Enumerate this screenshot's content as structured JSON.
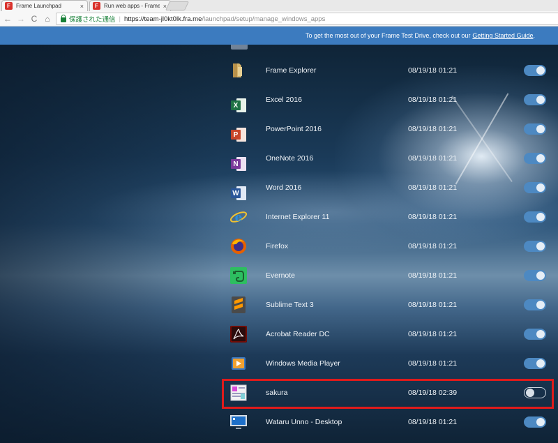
{
  "browser": {
    "tabs": [
      {
        "title": "Frame Launchpad",
        "favicon": "F",
        "close": "×"
      },
      {
        "title": "Run web apps - Frame De",
        "favicon": "F",
        "close": "×"
      }
    ],
    "nav": {
      "back": "←",
      "forward": "→",
      "reload": "C",
      "home": "⌂"
    },
    "address": {
      "secure_label": "保護された通信",
      "separator": "|",
      "host": "https://team-jl0kt0lk.fra.me",
      "path": "/launchpad/setup/manage_windows_apps"
    }
  },
  "banner": {
    "text": "To get the most out of your Frame Test Drive, check out our",
    "link": "Getting Started Guide",
    "trailing": "."
  },
  "apps": [
    {
      "name": "Frame Explorer",
      "date": "08/19/18 01:21",
      "icon": "folder-icon",
      "enabled": true
    },
    {
      "name": "Excel 2016",
      "date": "08/19/18 01:21",
      "icon": "excel-icon",
      "enabled": true
    },
    {
      "name": "PowerPoint 2016",
      "date": "08/19/18 01:21",
      "icon": "powerpoint-icon",
      "enabled": true
    },
    {
      "name": "OneNote 2016",
      "date": "08/19/18 01:21",
      "icon": "onenote-icon",
      "enabled": true
    },
    {
      "name": "Word 2016",
      "date": "08/19/18 01:21",
      "icon": "word-icon",
      "enabled": true
    },
    {
      "name": "Internet Explorer 11",
      "date": "08/19/18 01:21",
      "icon": "internet-explorer-icon",
      "enabled": true
    },
    {
      "name": "Firefox",
      "date": "08/19/18 01:21",
      "icon": "firefox-icon",
      "enabled": true
    },
    {
      "name": "Evernote",
      "date": "08/19/18 01:21",
      "icon": "evernote-icon",
      "enabled": true
    },
    {
      "name": "Sublime Text 3",
      "date": "08/19/18 01:21",
      "icon": "sublime-text-icon",
      "enabled": true
    },
    {
      "name": "Acrobat Reader DC",
      "date": "08/19/18 01:21",
      "icon": "acrobat-reader-icon",
      "enabled": true
    },
    {
      "name": "Windows Media Player",
      "date": "08/19/18 01:21",
      "icon": "windows-media-player-icon",
      "enabled": true
    },
    {
      "name": "sakura",
      "date": "08/19/18 02:39",
      "icon": "sakura-editor-icon",
      "enabled": false
    },
    {
      "name": "Wataru Unno - Desktop",
      "date": "08/19/18 01:21",
      "icon": "desktop-icon",
      "enabled": true
    }
  ],
  "colors": {
    "banner": "#3c7bbf",
    "toggle_on": "#4d89c2",
    "highlight": "#e01b1b",
    "secure": "#188038"
  }
}
